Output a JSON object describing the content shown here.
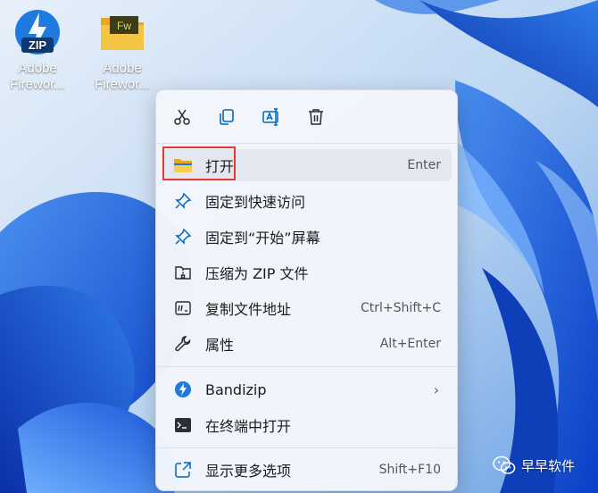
{
  "desktop": {
    "icons": [
      {
        "name": "zip-archive",
        "label_line1": "Adobe",
        "label_line2": "Firewor..."
      },
      {
        "name": "folder",
        "label_line1": "Adobe",
        "label_line2": "Firewor...",
        "logo_text": "Fw"
      }
    ]
  },
  "context_menu": {
    "quick_actions": [
      {
        "name": "cut",
        "icon": "scissors-icon"
      },
      {
        "name": "copy",
        "icon": "copy-icon"
      },
      {
        "name": "rename",
        "icon": "rename-icon"
      },
      {
        "name": "delete",
        "icon": "trash-icon"
      }
    ],
    "items": [
      {
        "label": "打开",
        "shortcut": "Enter",
        "icon": "folder-open-icon"
      },
      {
        "label": "固定到快速访问",
        "shortcut": "",
        "icon": "pin-icon"
      },
      {
        "label": "固定到“开始”屏幕",
        "shortcut": "",
        "icon": "pin-icon"
      },
      {
        "label": "压缩为 ZIP 文件",
        "shortcut": "",
        "icon": "zip-folder-icon"
      },
      {
        "label": "复制文件地址",
        "shortcut": "Ctrl+Shift+C",
        "icon": "path-copy-icon"
      },
      {
        "label": "属性",
        "shortcut": "Alt+Enter",
        "icon": "wrench-icon"
      },
      {
        "label": "Bandizip",
        "shortcut": "",
        "icon": "bandizip-icon",
        "submenu": true
      },
      {
        "label": "在终端中打开",
        "shortcut": "",
        "icon": "terminal-icon"
      },
      {
        "label": "显示更多选项",
        "shortcut": "Shift+F10",
        "icon": "more-options-icon"
      }
    ]
  },
  "watermark": {
    "text": "早早软件"
  },
  "colors": {
    "accent": "#0067c0",
    "highlight_border": "#e53935",
    "folder": "#f4c542"
  }
}
